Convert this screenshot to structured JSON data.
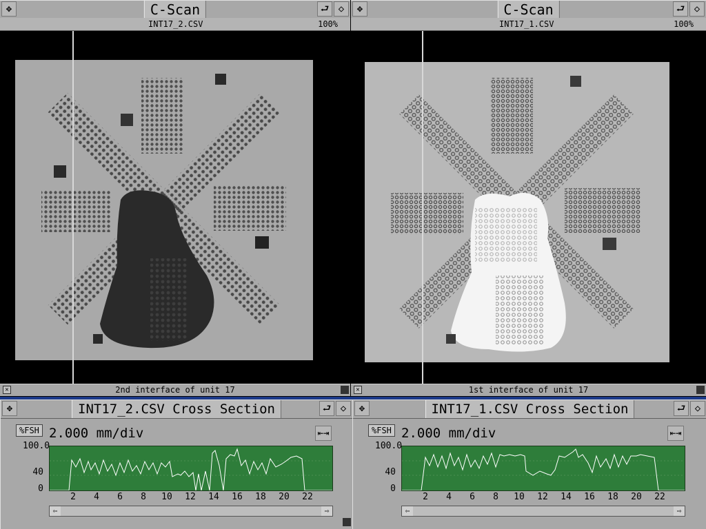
{
  "left_scan": {
    "title": "C-Scan",
    "filename": "INT17_2.CSV",
    "zoom": "100%",
    "status": "2nd interface of unit 17"
  },
  "right_scan": {
    "title": "C-Scan",
    "filename": "INT17_1.CSV",
    "zoom": "100%",
    "status": "1st interface of unit 17"
  },
  "left_cross": {
    "title": "INT17_2.CSV Cross Section",
    "unit_button": "%FSH",
    "scale": "2.000 mm/div",
    "y_ticks": [
      "100.0",
      "40",
      "0"
    ],
    "x_ticks": [
      "2",
      "4",
      "6",
      "8",
      "10",
      "12",
      "14",
      "16",
      "18",
      "20",
      "22"
    ]
  },
  "right_cross": {
    "title": "INT17_1.CSV Cross Section",
    "unit_button": "%FSH",
    "scale": "2.000 mm/div",
    "y_ticks": [
      "100.0",
      "40",
      "0"
    ],
    "x_ticks": [
      "2",
      "4",
      "6",
      "8",
      "10",
      "12",
      "14",
      "16",
      "18",
      "20",
      "22"
    ]
  },
  "colors": {
    "plot_bg": "#2e7d3a",
    "chrome": "#a8a8a8",
    "divider": "#1c3a8a"
  },
  "icons": [
    "move-icon",
    "return-icon",
    "diamond-icon",
    "close-box-icon",
    "resize-box-icon",
    "expand-icon",
    "arrow-left-icon",
    "arrow-right-icon"
  ]
}
